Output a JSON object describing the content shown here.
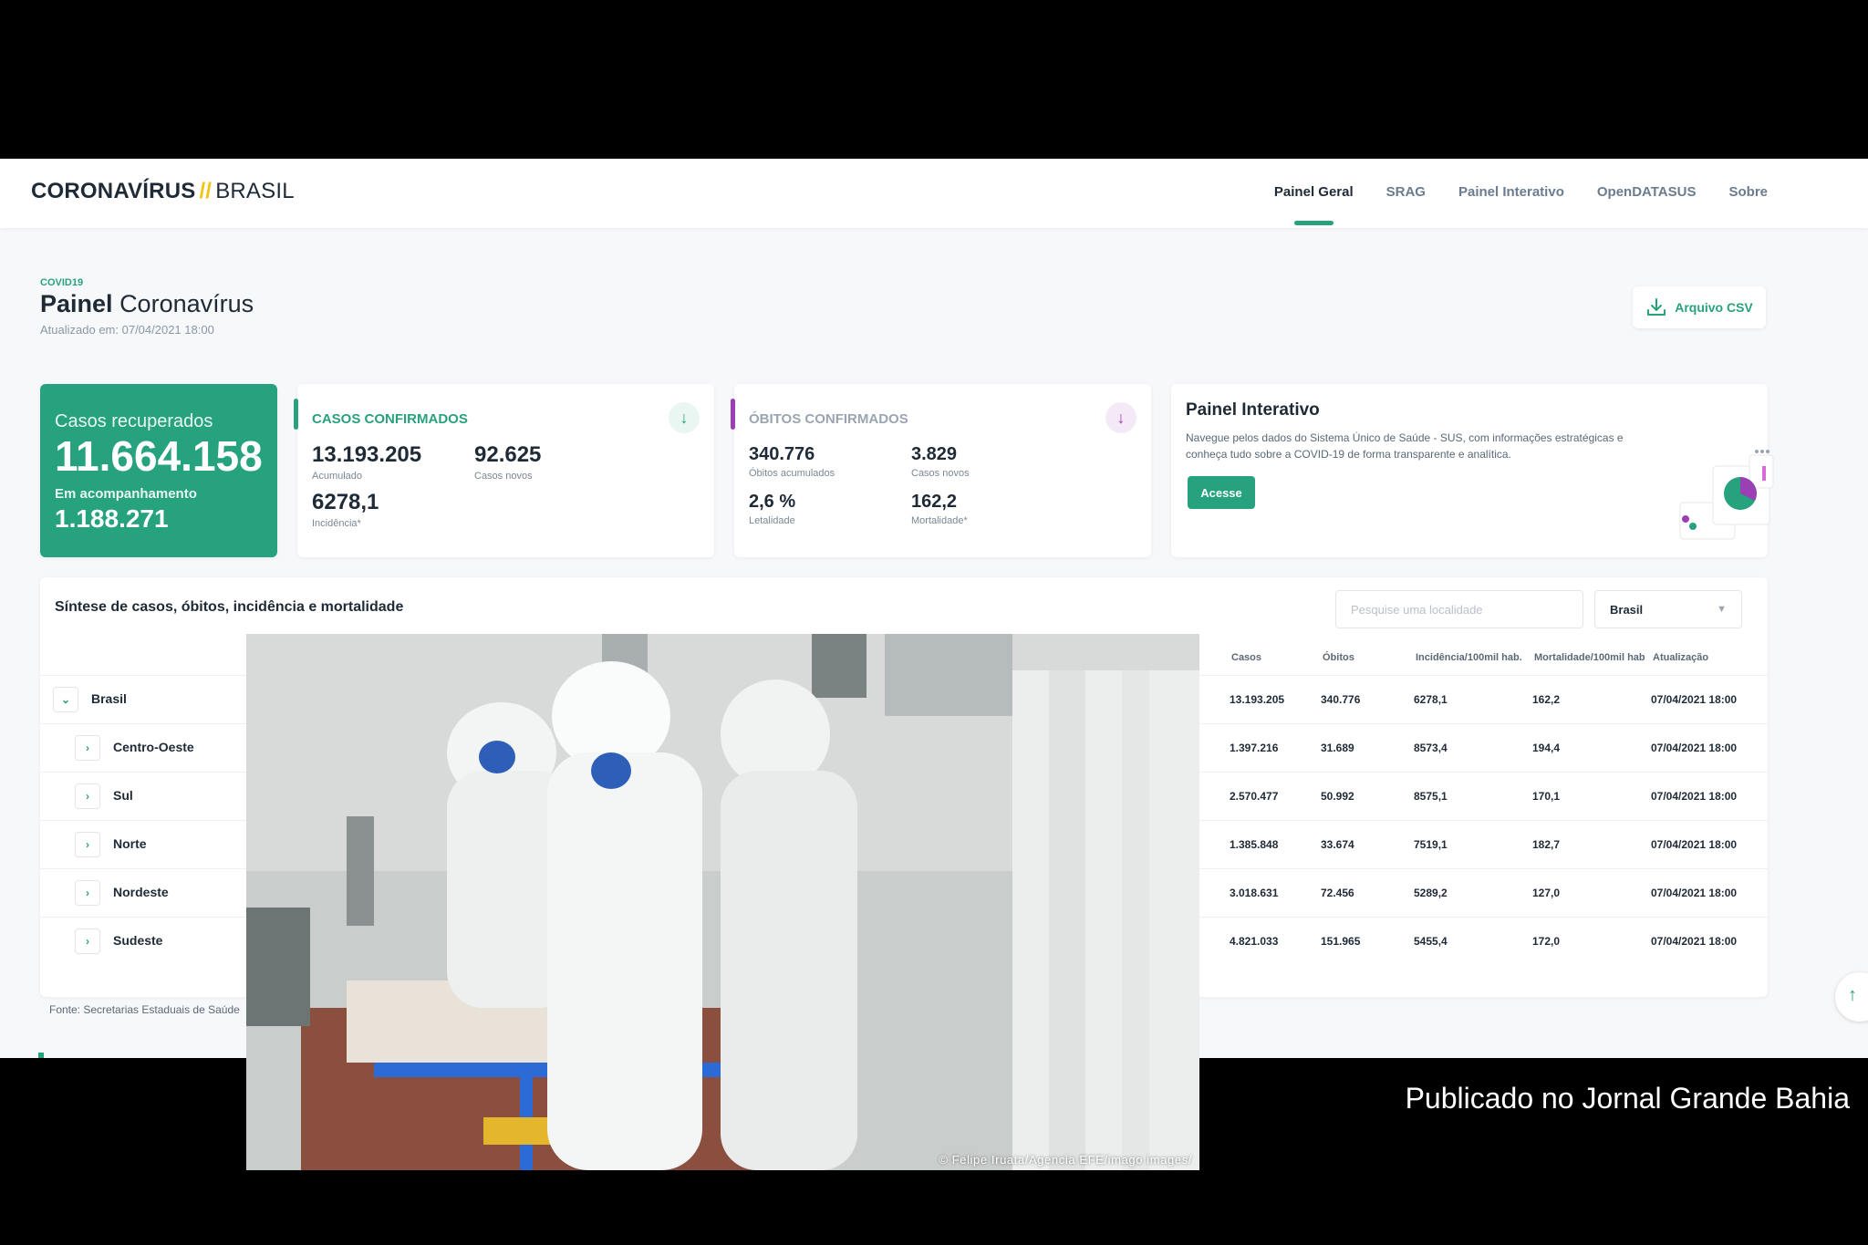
{
  "brand": {
    "part1": "CORONAVÍRUS",
    "slash": "//",
    "part2": "BRASIL"
  },
  "nav": [
    "Painel Geral",
    "SRAG",
    "Painel Interativo",
    "OpenDATASUS",
    "Sobre"
  ],
  "header": {
    "kicker": "COVID19",
    "title_bold": "Painel",
    "title_rest": "Coronavírus",
    "updated": "Atualizado em: 07/04/2021 18:00",
    "csv_label": "Arquivo CSV"
  },
  "recovered": {
    "label": "Casos recuperados",
    "value": "11.664.158",
    "sub_label": "Em acompanhamento",
    "sub_value": "1.188.271"
  },
  "cases": {
    "title": "CASOS CONFIRMADOS",
    "accumulated": "13.193.205",
    "accumulated_label": "Acumulado",
    "new": "92.625",
    "new_label": "Casos novos",
    "incidence": "6278,1",
    "incidence_label": "Incidência*"
  },
  "deaths": {
    "title": "ÓBITOS CONFIRMADOS",
    "accumulated": "340.776",
    "accumulated_label": "Óbitos acumulados",
    "new": "3.829",
    "new_label": "Casos novos",
    "lethality": "2,6 %",
    "lethality_label": "Letalidade",
    "mortality": "162,2",
    "mortality_label": "Mortalidade*"
  },
  "panel": {
    "title": "Painel Interativo",
    "desc": "Navegue pelos dados do Sistema Único de Saúde - SUS, com informações estratégicas e conheça tudo sobre a COVID-19 de forma transparente e analítica.",
    "button": "Acesse"
  },
  "table": {
    "title": "Síntese de casos, óbitos, incidência e mortalidade",
    "search_placeholder": "Pesquise uma localidade",
    "select_value": "Brasil",
    "headers": [
      "Casos",
      "Óbitos",
      "Incidência/100mil hab.",
      "Mortalidade/100mil hab",
      "Atualização"
    ],
    "rows": [
      {
        "name": "Brasil",
        "casos": "13.193.205",
        "obitos": "340.776",
        "incidencia": "6278,1",
        "mortalidade": "162,2",
        "atualizacao": "07/04/2021 18:00"
      },
      {
        "name": "Centro-Oeste",
        "casos": "1.397.216",
        "obitos": "31.689",
        "incidencia": "8573,4",
        "mortalidade": "194,4",
        "atualizacao": "07/04/2021 18:00"
      },
      {
        "name": "Sul",
        "casos": "2.570.477",
        "obitos": "50.992",
        "incidencia": "8575,1",
        "mortalidade": "170,1",
        "atualizacao": "07/04/2021 18:00"
      },
      {
        "name": "Norte",
        "casos": "1.385.848",
        "obitos": "33.674",
        "incidencia": "7519,1",
        "mortalidade": "182,7",
        "atualizacao": "07/04/2021 18:00"
      },
      {
        "name": "Nordeste",
        "casos": "3.018.631",
        "obitos": "72.456",
        "incidencia": "5289,2",
        "mortalidade": "127,0",
        "atualizacao": "07/04/2021 18:00"
      },
      {
        "name": "Sudeste",
        "casos": "4.821.033",
        "obitos": "151.965",
        "incidencia": "5455,4",
        "mortalidade": "172,0",
        "atualizacao": "07/04/2021 18:00"
      }
    ]
  },
  "fonte": "Fonte: Secretarias Estaduais de Saúde",
  "photo_credit": "© Felipe Iruata/Agencia EFE/imago images/",
  "caption": "Publicado no Jornal Grande Bahia",
  "colors": {
    "accent": "#26a27f",
    "purple": "#9b3fb4",
    "yellow": "#f1c40f"
  }
}
